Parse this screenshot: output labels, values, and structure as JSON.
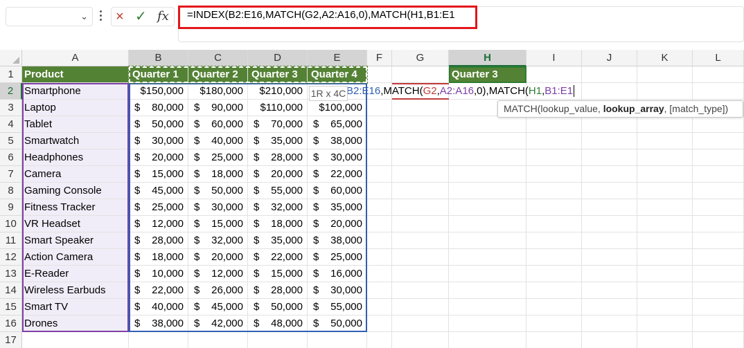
{
  "formula_bar": {
    "name_box": "",
    "cancel_icon": "×",
    "enter_icon": "✓",
    "fx_label": "fx",
    "formula": "=INDEX(B2:E16,MATCH(G2,A2:A16,0),MATCH(H1,B1:E1"
  },
  "columns": [
    "A",
    "B",
    "C",
    "D",
    "E",
    "F",
    "G",
    "H",
    "I",
    "J",
    "K",
    "L"
  ],
  "rows": [
    "1",
    "2",
    "3",
    "4",
    "5",
    "6",
    "7",
    "8",
    "9",
    "10",
    "11",
    "12",
    "13",
    "14",
    "15",
    "16",
    "17"
  ],
  "headers": [
    "Product",
    "Quarter 1",
    "Quarter 2",
    "Quarter 3",
    "Quarter 4"
  ],
  "h1_value": "Quarter 3",
  "table": [
    [
      "Smartphone",
      "150,000",
      "180,000",
      "210,000",
      ""
    ],
    [
      "Laptop",
      "80,000",
      "90,000",
      "110,000",
      "100,000"
    ],
    [
      "Tablet",
      "50,000",
      "60,000",
      "70,000",
      "65,000"
    ],
    [
      "Smartwatch",
      "30,000",
      "40,000",
      "35,000",
      "38,000"
    ],
    [
      "Headphones",
      "20,000",
      "25,000",
      "28,000",
      "30,000"
    ],
    [
      "Camera",
      "15,000",
      "18,000",
      "20,000",
      "22,000"
    ],
    [
      "Gaming Console",
      "45,000",
      "50,000",
      "55,000",
      "60,000"
    ],
    [
      "Fitness Tracker",
      "25,000",
      "30,000",
      "32,000",
      "35,000"
    ],
    [
      "VR Headset",
      "12,000",
      "15,000",
      "18,000",
      "20,000"
    ],
    [
      "Smart Speaker",
      "28,000",
      "32,000",
      "35,000",
      "38,000"
    ],
    [
      "Action Camera",
      "18,000",
      "20,000",
      "22,000",
      "25,000"
    ],
    [
      "E-Reader",
      "10,000",
      "12,000",
      "15,000",
      "16,000"
    ],
    [
      "Wireless Earbuds",
      "22,000",
      "26,000",
      "28,000",
      "30,000"
    ],
    [
      "Smart TV",
      "40,000",
      "45,000",
      "50,000",
      "55,000"
    ],
    [
      "Drones",
      "38,000",
      "42,000",
      "48,000",
      "50,000"
    ]
  ],
  "currency_symbol": "$",
  "selection_size": "1R x 4C",
  "inline_formula": {
    "prefix": "=",
    "p1": "B2:E16",
    "p2": ",MATCH(",
    "p3": "G2",
    "p4": ",",
    "p5": "A2:A16",
    "p6": ",0),MATCH(",
    "p7": "H1",
    "p8": ",",
    "p9": "B1:E1"
  },
  "tooltip": {
    "fn": "MATCH(lookup_value, ",
    "bold": "lookup_array",
    "rest": ", [match_type])"
  },
  "colors": {
    "header_green": "#548235",
    "range_blue": "#2f5fb3",
    "range_red": "#c23b3b",
    "range_purple": "#7e3fa6",
    "range_green": "#2e7d32",
    "highlight_red": "#e3161b"
  }
}
